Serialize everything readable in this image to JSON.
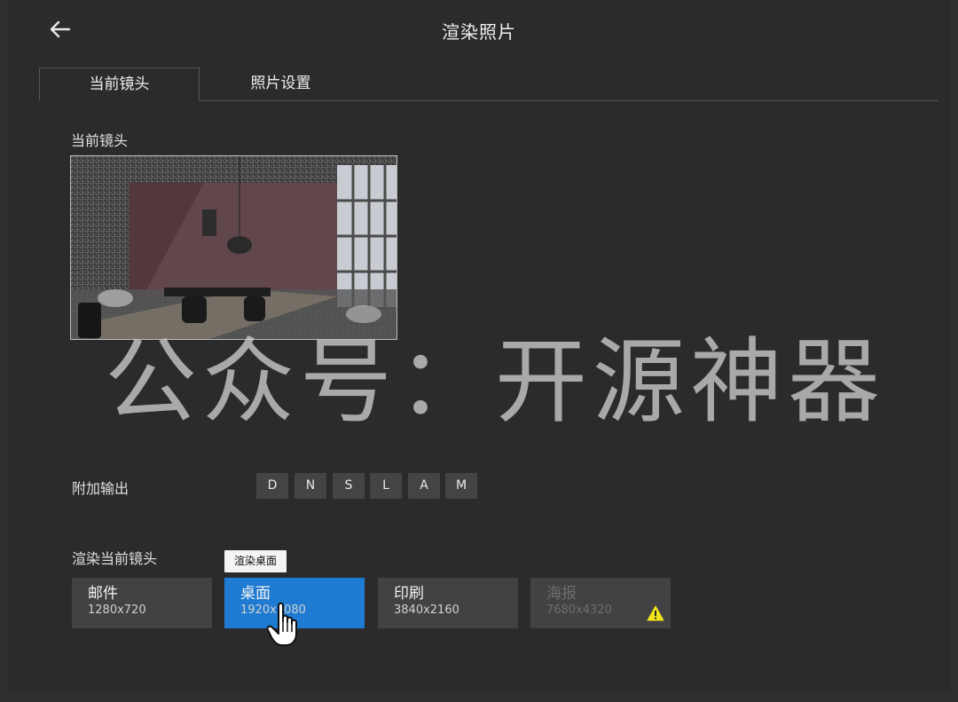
{
  "header": {
    "title": "渲染照片"
  },
  "tabs": [
    {
      "label": "当前镜头"
    },
    {
      "label": "照片设置"
    }
  ],
  "camera_section": {
    "label": "当前镜头"
  },
  "watermark": {
    "text": "公众号：开源神器"
  },
  "extra_outputs": {
    "label": "附加输出",
    "buttons": [
      "D",
      "N",
      "S",
      "L",
      "A",
      "M"
    ]
  },
  "render_section": {
    "label": "渲染当前镜头",
    "tooltip": "渲染桌面",
    "presets": [
      {
        "name": "邮件",
        "resolution": "1280x720"
      },
      {
        "name": "桌面",
        "resolution": "1920x1080"
      },
      {
        "name": "印刷",
        "resolution": "3840x2160"
      },
      {
        "name": "海报",
        "resolution": "7680x4320"
      }
    ]
  },
  "colors": {
    "accent": "#1e7bd1",
    "warning": "#f2e21c",
    "background": "#2b2b2d"
  },
  "icons": [
    "back-arrow-icon",
    "warning-icon",
    "hand-cursor-icon"
  ]
}
